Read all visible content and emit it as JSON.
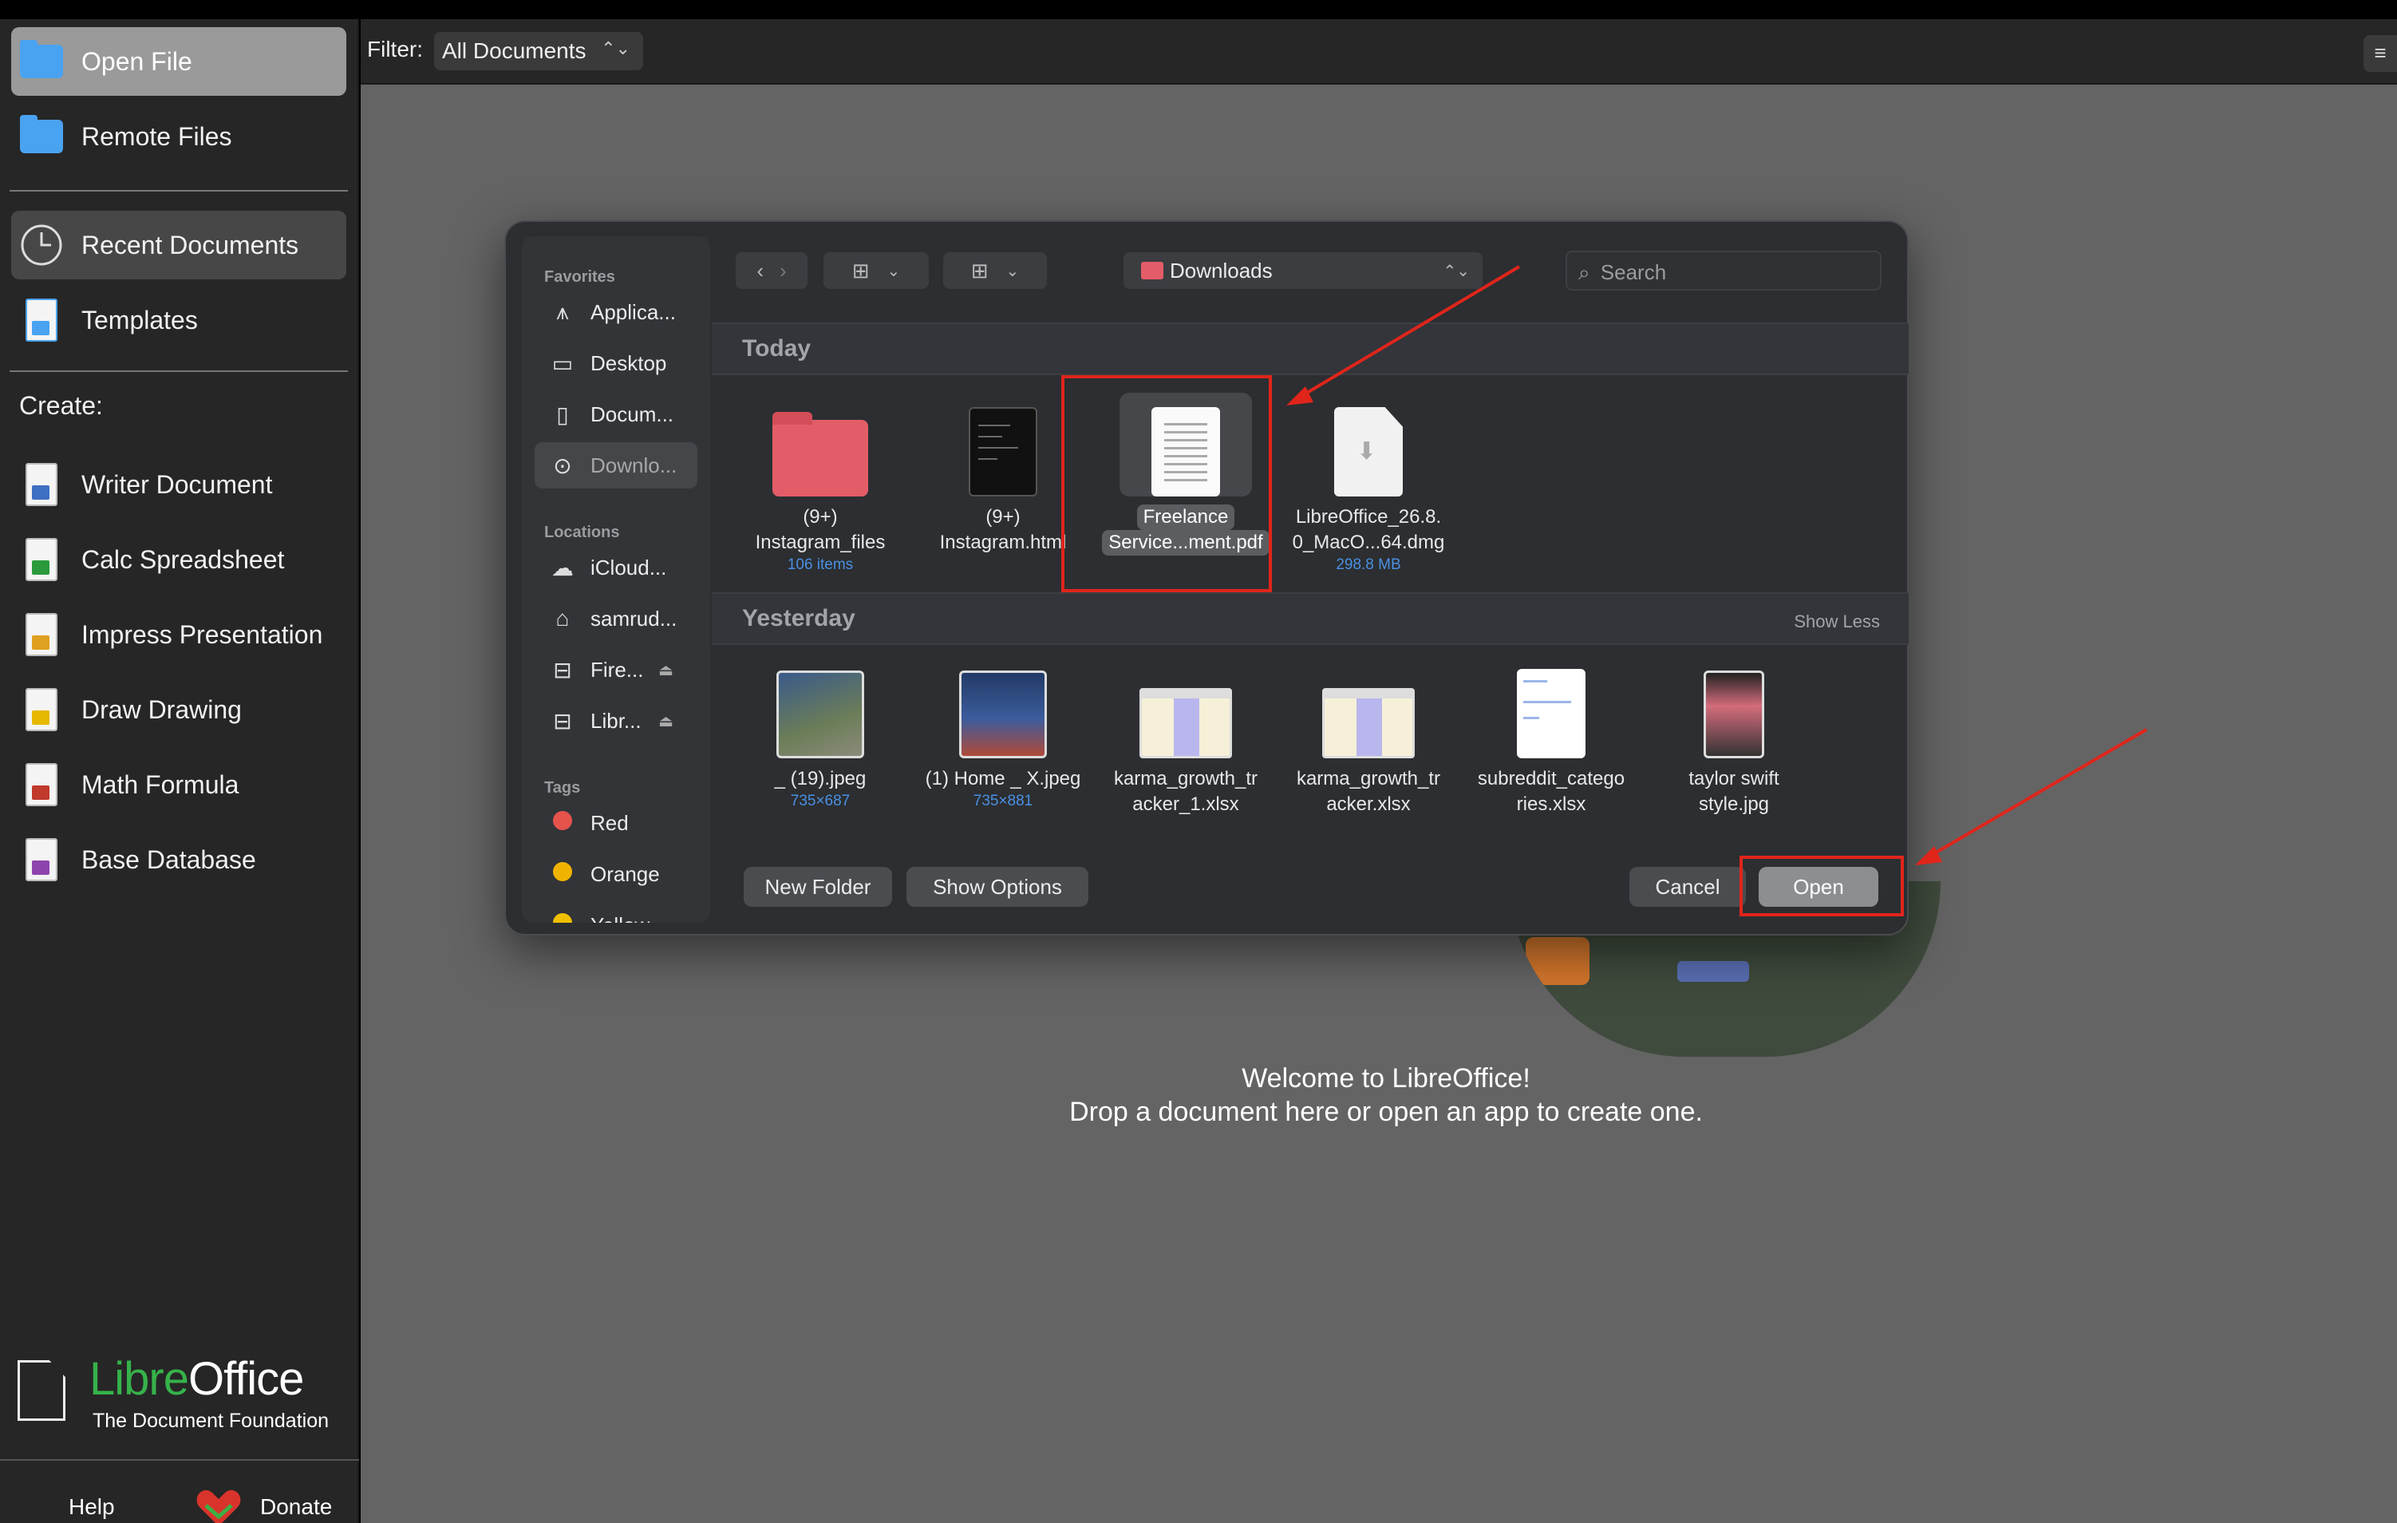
{
  "sidebar": {
    "open_file": "Open File",
    "remote_files": "Remote Files",
    "recent_documents": "Recent Documents",
    "templates": "Templates",
    "create_label": "Create:",
    "create_items": [
      {
        "label": "Writer Document",
        "color": "#3d6fc2"
      },
      {
        "label": "Calc Spreadsheet",
        "color": "#2a9a3c"
      },
      {
        "label": "Impress Presentation",
        "color": "#e0a020"
      },
      {
        "label": "Draw Drawing",
        "color": "#e6b800"
      },
      {
        "label": "Math Formula",
        "color": "#c0392b"
      },
      {
        "label": "Base Database",
        "color": "#8e44ad"
      }
    ],
    "logo_libre": "Libre",
    "logo_office": "Office",
    "logo_sub": "The Document Foundation",
    "help": "Help",
    "donate": "Donate"
  },
  "filter": {
    "label": "Filter:",
    "value": "All Documents"
  },
  "welcome": {
    "line1": "Welcome to LibreOffice!",
    "line2": "Drop a document here or open an app to create one."
  },
  "dialog": {
    "favorites_header": "Favorites",
    "favorites": [
      {
        "label": "Applica...",
        "icon": "applications-icon"
      },
      {
        "label": "Desktop",
        "icon": "desktop-icon"
      },
      {
        "label": "Docum...",
        "icon": "document-icon"
      },
      {
        "label": "Downlo...",
        "icon": "downloads-icon"
      }
    ],
    "locations_header": "Locations",
    "locations": [
      {
        "label": "iCloud...",
        "icon": "cloud-icon"
      },
      {
        "label": "samrud...",
        "icon": "home-icon"
      },
      {
        "label": "Fire...",
        "icon": "drive-icon"
      },
      {
        "label": "Libr...",
        "icon": "drive-icon"
      }
    ],
    "tags_header": "Tags",
    "tags": [
      {
        "label": "Red",
        "color": "#e5534b"
      },
      {
        "label": "Orange",
        "color": "#f0b400"
      },
      {
        "label": "Yellow",
        "color": "#f0c000"
      }
    ],
    "location": "Downloads",
    "search_placeholder": "Search",
    "today_header": "Today",
    "yesterday_header": "Yesterday",
    "show_less": "Show Less",
    "today_files": [
      {
        "line1": "(9+)",
        "line2": "Instagram_files",
        "meta": "106 items"
      },
      {
        "line1": "(9+)",
        "line2": "Instagram.html",
        "meta": ""
      },
      {
        "line1": "Freelance",
        "line2": "Service...ment.pdf",
        "meta": ""
      },
      {
        "line1": "LibreOffice_26.8.",
        "line2": "0_MacO...64.dmg",
        "meta": "298.8 MB"
      }
    ],
    "yesterday_files": [
      {
        "line1": "_ (19).jpeg",
        "line2": "",
        "meta": "735×687"
      },
      {
        "line1": "(1) Home _ X.jpeg",
        "line2": "",
        "meta": "735×881"
      },
      {
        "line1": "karma_growth_tr",
        "line2": "acker_1.xlsx",
        "meta": ""
      },
      {
        "line1": "karma_growth_tr",
        "line2": "acker.xlsx",
        "meta": ""
      },
      {
        "line1": "subreddit_catego",
        "line2": "ries.xlsx",
        "meta": ""
      },
      {
        "line1": "taylor swift",
        "line2": "style.jpg",
        "meta": ""
      }
    ],
    "new_folder": "New Folder",
    "show_options": "Show Options",
    "cancel": "Cancel",
    "open": "Open"
  },
  "colors": {
    "annotation": "#e0251b",
    "accent": "#4aa3f0"
  }
}
